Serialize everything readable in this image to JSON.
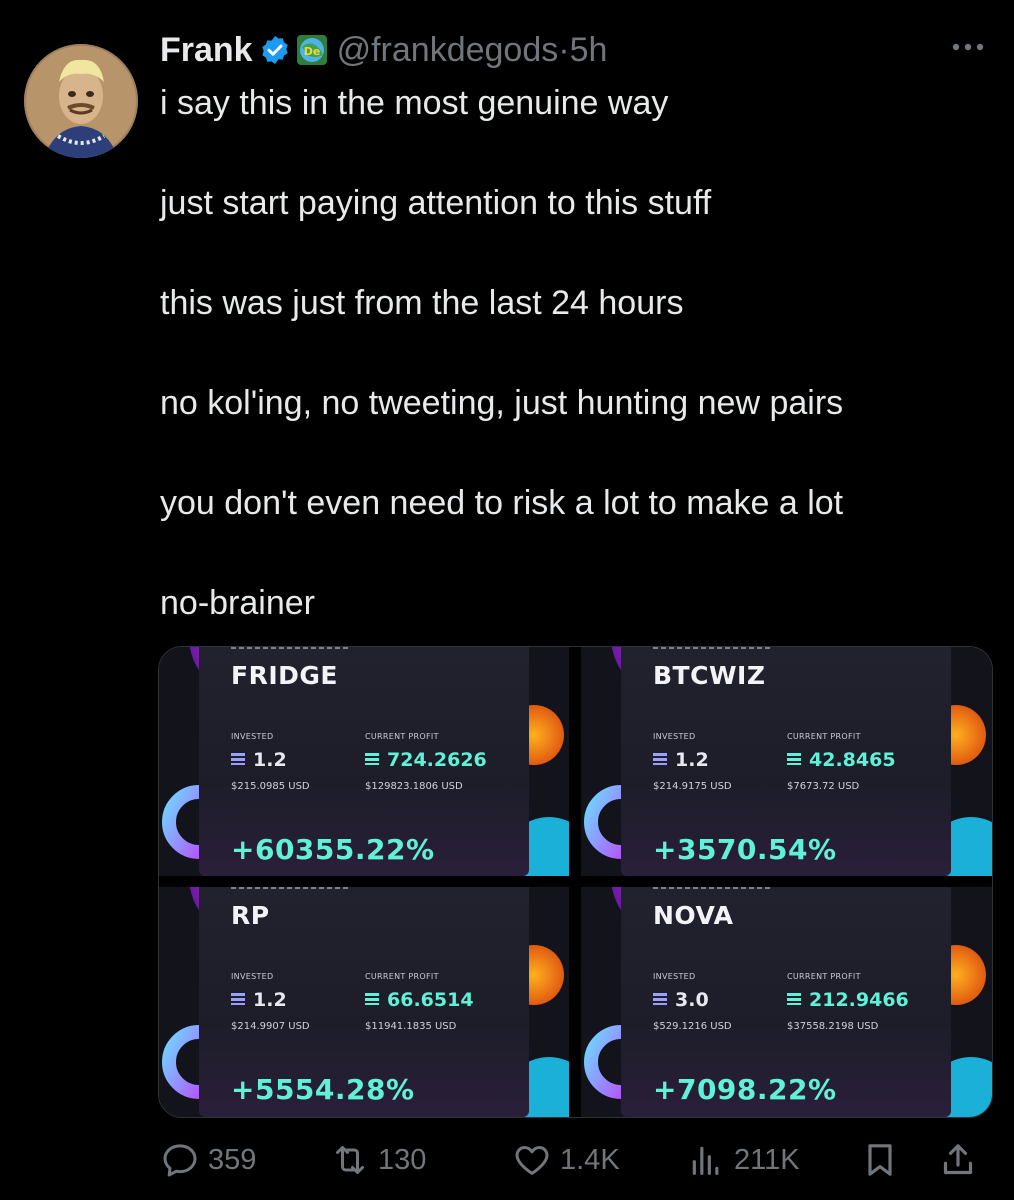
{
  "author": {
    "name": "Frank",
    "handle": "@frankdegods",
    "separator": "·",
    "time": "5h",
    "affiliate_badge": "De"
  },
  "tweet": {
    "lines": [
      "i say this in the most genuine way",
      "just start paying attention to this stuff",
      "this was just from the last 24 hours",
      "no kol'ing, no tweeting, just hunting new pairs",
      "you don't even need to risk a lot to make a lot",
      "no-brainer"
    ]
  },
  "media": {
    "invested_label": "INVESTED",
    "profit_label": "CURRENT PROFIT",
    "cards": [
      {
        "ticker": "FRIDGE",
        "invested": "1.2",
        "invested_usd": "$215.0985 USD",
        "profit": "724.2626",
        "profit_usd": "$129823.1806 USD",
        "percent": "+60355.22%"
      },
      {
        "ticker": "BTCWIZ",
        "invested": "1.2",
        "invested_usd": "$214.9175 USD",
        "profit": "42.8465",
        "profit_usd": "$7673.72 USD",
        "percent": "+3570.54%"
      },
      {
        "ticker": "RP",
        "invested": "1.2",
        "invested_usd": "$214.9907 USD",
        "profit": "66.6514",
        "profit_usd": "$11941.1835 USD",
        "percent": "+5554.28%"
      },
      {
        "ticker": "NOVA",
        "invested": "3.0",
        "invested_usd": "$529.1216 USD",
        "profit": "212.9466",
        "profit_usd": "$37558.2198 USD",
        "percent": "+7098.22%"
      }
    ]
  },
  "actions": {
    "replies": "359",
    "reposts": "130",
    "likes": "1.4K",
    "views": "211K"
  },
  "colors": {
    "background": "#000000",
    "text": "#e7e9ea",
    "muted": "#71767b",
    "verified": "#1d9bf0",
    "profit_accent": "#5ff2d8"
  }
}
